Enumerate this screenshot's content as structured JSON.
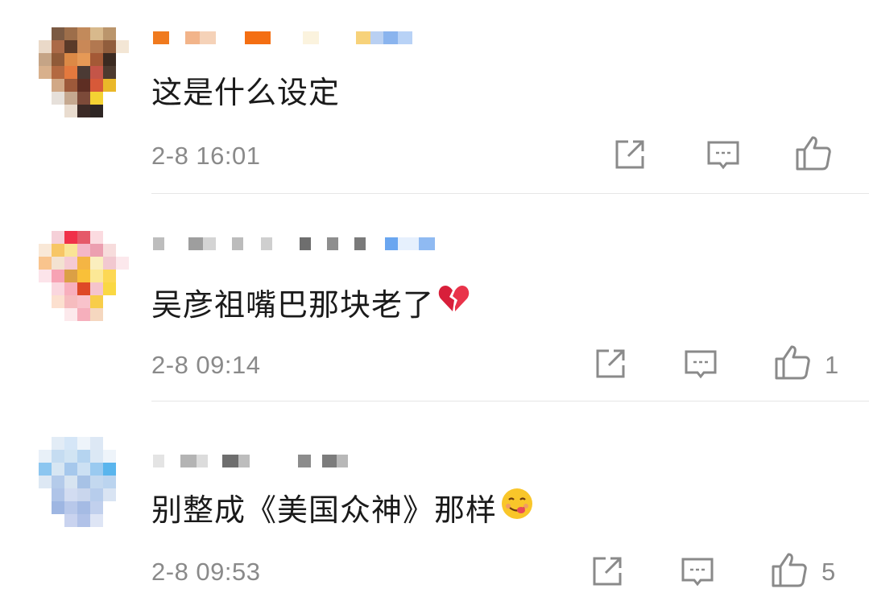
{
  "comments": [
    {
      "text": "这是什么设定",
      "time": "2-8 16:01",
      "likes": "",
      "emoji": ""
    },
    {
      "text": "吴彦祖嘴巴那块老了",
      "time": "2-8 09:14",
      "likes": "1",
      "emoji": "broken-heart-emoji"
    },
    {
      "text": "别整成《美国众神》那样",
      "time": "2-8 09:53",
      "likes": "5",
      "emoji": "yummy-face-emoji"
    }
  ],
  "icons": {
    "repost": "repost-icon",
    "comment": "comment-icon",
    "like": "thumbs-up-icon"
  },
  "colors": {
    "text": "#1a1a1a",
    "meta": "#8a8a8a",
    "divider": "#e6e6e6"
  }
}
